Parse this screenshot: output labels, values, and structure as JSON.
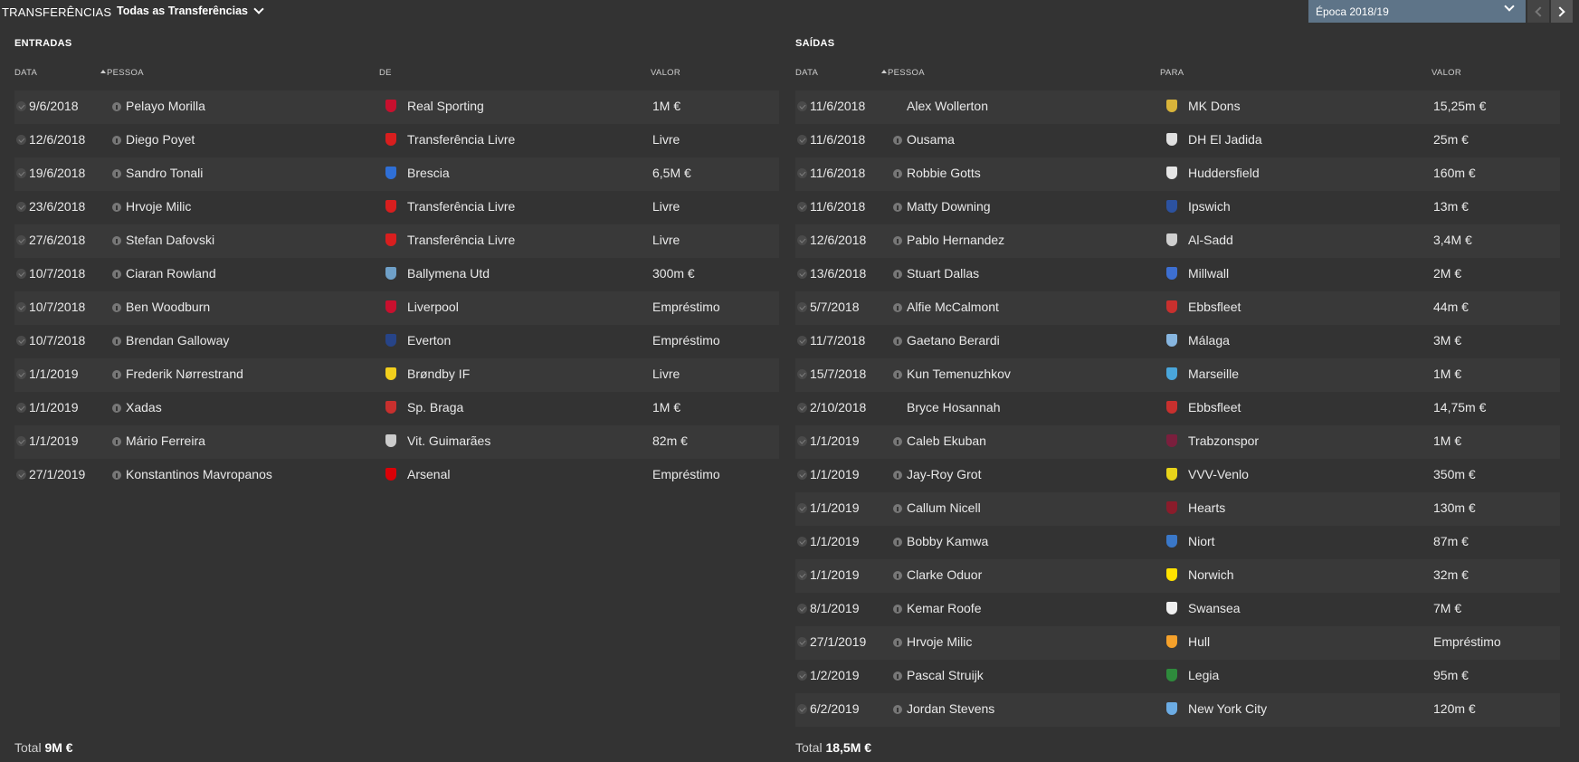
{
  "header": {
    "title": "TRANSFERÊNCIAS",
    "filter_label": "Todas as Transferências",
    "season_label": "Época 2018/19"
  },
  "incoming": {
    "title": "ENTRADAS",
    "headers": {
      "date": "DATA",
      "person": "PESSOA",
      "club": "DE",
      "value": "VALOR"
    },
    "rows": [
      {
        "date": "9/6/2018",
        "person": "Pelayo Morilla",
        "info": true,
        "club": "Real Sporting",
        "crest": "#c8102e",
        "value": "1M €"
      },
      {
        "date": "12/6/2018",
        "person": "Diego Poyet",
        "info": true,
        "club": "Transferência Livre",
        "crest": "#d81e1e",
        "value": "Livre"
      },
      {
        "date": "19/6/2018",
        "person": "Sandro Tonali",
        "info": true,
        "club": "Brescia",
        "crest": "#2f6fd6",
        "value": "6,5M €"
      },
      {
        "date": "23/6/2018",
        "person": "Hrvoje Milic",
        "info": true,
        "club": "Transferência Livre",
        "crest": "#d81e1e",
        "value": "Livre"
      },
      {
        "date": "27/6/2018",
        "person": "Stefan Dafovski",
        "info": true,
        "club": "Transferência Livre",
        "crest": "#d81e1e",
        "value": "Livre"
      },
      {
        "date": "10/7/2018",
        "person": "Ciaran Rowland",
        "info": true,
        "club": "Ballymena Utd",
        "crest": "#6fa0c8",
        "value": "300m €"
      },
      {
        "date": "10/7/2018",
        "person": "Ben Woodburn",
        "info": true,
        "club": "Liverpool",
        "crest": "#c8102e",
        "value": "Empréstimo"
      },
      {
        "date": "10/7/2018",
        "person": "Brendan Galloway",
        "info": true,
        "club": "Everton",
        "crest": "#274488",
        "value": "Empréstimo"
      },
      {
        "date": "1/1/2019",
        "person": "Frederik Nørrestrand",
        "info": true,
        "club": "Brøndby IF",
        "crest": "#f2cf1d",
        "value": "Livre"
      },
      {
        "date": "1/1/2019",
        "person": "Xadas",
        "info": true,
        "club": "Sp. Braga",
        "crest": "#c8302e",
        "value": "1M €"
      },
      {
        "date": "1/1/2019",
        "person": "Mário Ferreira",
        "info": true,
        "club": "Vit. Guimarães",
        "crest": "#cccccc",
        "value": "82m €"
      },
      {
        "date": "27/1/2019",
        "person": "Konstantinos Mavropanos",
        "info": true,
        "club": "Arsenal",
        "crest": "#db0007",
        "value": "Empréstimo"
      }
    ],
    "total_label": "Total",
    "total_value": "9M €"
  },
  "outgoing": {
    "title": "SAÍDAS",
    "headers": {
      "date": "DATA",
      "person": "PESSOA",
      "club": "PARA",
      "value": "VALOR"
    },
    "rows": [
      {
        "date": "11/6/2018",
        "person": "Alex Wollerton",
        "info": false,
        "club": "MK Dons",
        "crest": "#d9b43a",
        "value": "15,25m €"
      },
      {
        "date": "11/6/2018",
        "person": "Ousama",
        "info": true,
        "club": "DH El Jadida",
        "crest": "#e0e0e0",
        "value": "25m €"
      },
      {
        "date": "11/6/2018",
        "person": "Robbie Gotts",
        "info": true,
        "club": "Huddersfield",
        "crest": "#e6e6e6",
        "value": "160m €"
      },
      {
        "date": "11/6/2018",
        "person": "Matty Downing",
        "info": true,
        "club": "Ipswich",
        "crest": "#2c52a0",
        "value": "13m €"
      },
      {
        "date": "12/6/2018",
        "person": "Pablo Hernandez",
        "info": true,
        "club": "Al-Sadd",
        "crest": "#cfcfcf",
        "value": "3,4M €"
      },
      {
        "date": "13/6/2018",
        "person": "Stuart Dallas",
        "info": true,
        "club": "Millwall",
        "crest": "#3d6fd1",
        "value": "2M €"
      },
      {
        "date": "5/7/2018",
        "person": "Alfie McCalmont",
        "info": true,
        "club": "Ebbsfleet",
        "crest": "#c8302e",
        "value": "44m €"
      },
      {
        "date": "11/7/2018",
        "person": "Gaetano Berardi",
        "info": true,
        "club": "Málaga",
        "crest": "#87b6e0",
        "value": "3M €"
      },
      {
        "date": "15/7/2018",
        "person": "Kun Temenuzhkov",
        "info": true,
        "club": "Marseille",
        "crest": "#4aa6db",
        "value": "1M €"
      },
      {
        "date": "2/10/2018",
        "person": "Bryce Hosannah",
        "info": false,
        "club": "Ebbsfleet",
        "crest": "#c8302e",
        "value": "14,75m €"
      },
      {
        "date": "1/1/2019",
        "person": "Caleb Ekuban",
        "info": true,
        "club": "Trabzonspor",
        "crest": "#7a1f3d",
        "value": "1M €"
      },
      {
        "date": "1/1/2019",
        "person": "Jay-Roy Grot",
        "info": true,
        "club": "VVV-Venlo",
        "crest": "#e8d41a",
        "value": "350m €"
      },
      {
        "date": "1/1/2019",
        "person": "Callum Nicell",
        "info": true,
        "club": "Hearts",
        "crest": "#8a1c2b",
        "value": "130m €"
      },
      {
        "date": "1/1/2019",
        "person": "Bobby Kamwa",
        "info": true,
        "club": "Niort",
        "crest": "#3a78c9",
        "value": "87m €"
      },
      {
        "date": "1/1/2019",
        "person": "Clarke Oduor",
        "info": true,
        "club": "Norwich",
        "crest": "#ffe200",
        "value": "32m €"
      },
      {
        "date": "8/1/2019",
        "person": "Kemar Roofe",
        "info": true,
        "club": "Swansea",
        "crest": "#f0f0f0",
        "value": "7M €"
      },
      {
        "date": "27/1/2019",
        "person": "Hrvoje Milic",
        "info": true,
        "club": "Hull",
        "crest": "#f5a12b",
        "value": "Empréstimo"
      },
      {
        "date": "1/2/2019",
        "person": "Pascal Struijk",
        "info": true,
        "club": "Legia",
        "crest": "#2e8b3c",
        "value": "95m €"
      },
      {
        "date": "6/2/2019",
        "person": "Jordan Stevens",
        "info": true,
        "club": "New York City",
        "crest": "#6cace4",
        "value": "120m €"
      }
    ],
    "total_label": "Total",
    "total_value": "18,5M €"
  }
}
